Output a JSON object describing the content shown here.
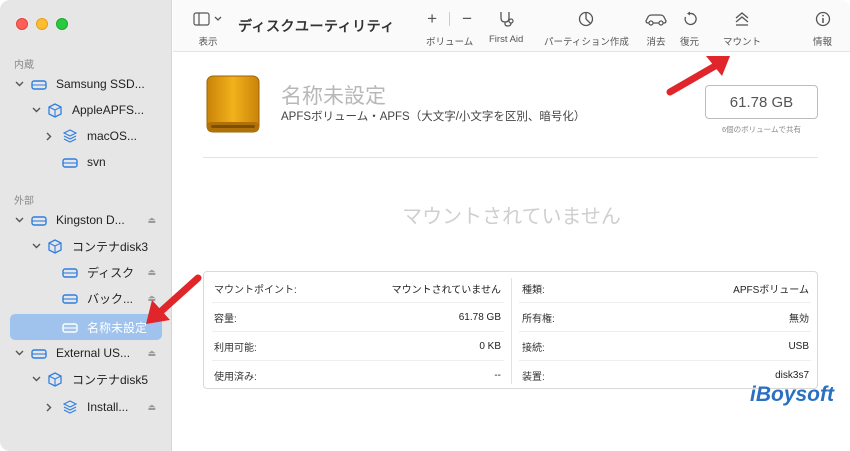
{
  "sidebar": {
    "internal_label": "内蔵",
    "external_label": "外部",
    "items": [
      {
        "label": "Samsung SSD..."
      },
      {
        "label": "AppleAPFS..."
      },
      {
        "label": "macOS..."
      },
      {
        "label": "svn"
      },
      {
        "label": "Kingston D..."
      },
      {
        "label": "コンテナdisk3"
      },
      {
        "label": "ディスク"
      },
      {
        "label": "バック..."
      },
      {
        "label": "名称未設定"
      },
      {
        "label": "External US..."
      },
      {
        "label": "コンテナdisk5"
      },
      {
        "label": "Install..."
      }
    ]
  },
  "toolbar": {
    "view_label": "表示",
    "title": "ディスクユーティリティ",
    "add_glyph": "+",
    "remove_glyph": "−",
    "volume_label": "ボリューム",
    "firstaid_label": "First Aid",
    "partition_label": "パーティション作成",
    "erase_label": "消去",
    "restore_label": "復元",
    "mount_label": "マウント",
    "info_label": "情報"
  },
  "volume": {
    "name": "名称未設定",
    "description": "APFSボリューム・APFS（大文字/小文字を区別、暗号化）",
    "size": "61.78 GB",
    "shared_note": "6個のボリュームで共有",
    "unmounted_message": "マウントされていません"
  },
  "details": {
    "left": [
      {
        "key": "マウントポイント:",
        "value": "マウントされていません"
      },
      {
        "key": "容量:",
        "value": "61.78 GB"
      },
      {
        "key": "利用可能:",
        "value": "0 KB"
      },
      {
        "key": "使用済み:",
        "value": "--"
      }
    ],
    "right": [
      {
        "key": "種類:",
        "value": "APFSボリューム"
      },
      {
        "key": "所有権:",
        "value": "無効"
      },
      {
        "key": "接続:",
        "value": "USB"
      },
      {
        "key": "装置:",
        "value": "disk3s7"
      }
    ]
  },
  "watermark": "iBoysoft",
  "colors": {
    "accent": "#2f7fe0",
    "selection": "#9fc3ec",
    "arrow": "#e0262a",
    "disk_orange": "#e8a417"
  }
}
